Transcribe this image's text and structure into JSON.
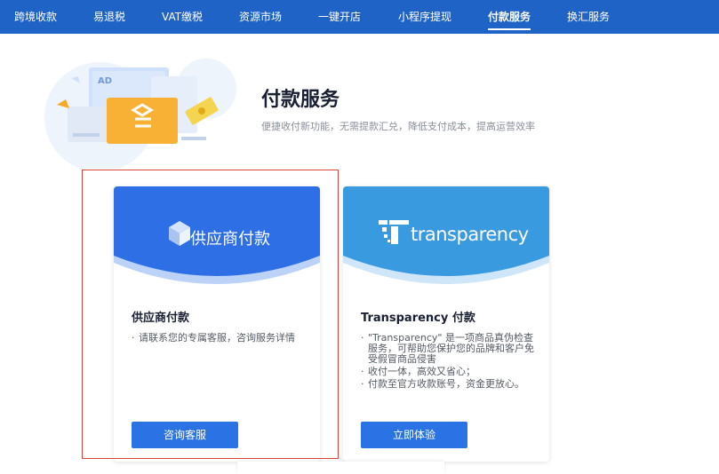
{
  "nav": {
    "items": [
      {
        "label": "跨境收款"
      },
      {
        "label": "易退税"
      },
      {
        "label": "VAT缴税"
      },
      {
        "label": "资源市场"
      },
      {
        "label": "一键开店"
      },
      {
        "label": "小程序提现"
      },
      {
        "label": "付款服务",
        "active": true
      },
      {
        "label": "换汇服务"
      }
    ]
  },
  "hero": {
    "title": "付款服务",
    "subtitle": "便捷收付新功能，无需提款汇兑，降低支付成本，提高运营效率",
    "illustration_label": "AD"
  },
  "cards": [
    {
      "banner_text": "供应商付款",
      "banner_color": "#2e6fe6",
      "title": "供应商付款",
      "items": [
        "请联系您的专属客服，咨询服务详情"
      ],
      "button": "咨询客服"
    },
    {
      "banner_text": "transparency",
      "banner_color": "#3a9ae0",
      "title": "Transparency 付款",
      "items": [
        "\"Transparency\" 是一项商品真伪检查服务，可帮助您保护您的品牌和客户免受假冒商品侵害",
        "收付一体，高效又省心；",
        "付款至官方收款账号，资金更放心。"
      ],
      "button": "立即体验"
    }
  ],
  "colors": {
    "nav_bg": "#1f63c7",
    "button": "#2b73e4",
    "selection_border": "#d9453b"
  }
}
